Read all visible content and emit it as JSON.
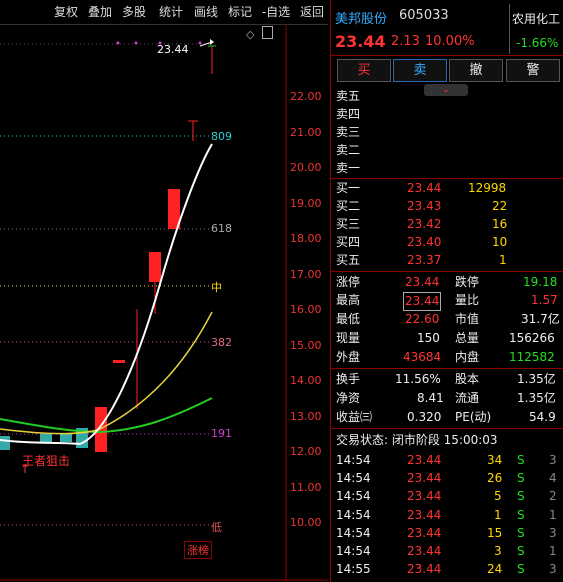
{
  "toolbar": {
    "items": [
      "复权",
      "叠加",
      "多股",
      "统计",
      "画线",
      "标记",
      "-自选",
      "返回"
    ]
  },
  "chart": {
    "price_label": "23.44",
    "y_ticks": [
      "22.00",
      "21.00",
      "20.00",
      "19.00",
      "18.00",
      "17.00",
      "16.00",
      "15.00",
      "14.00",
      "13.00",
      "12.00",
      "11.00",
      "10.00"
    ],
    "fib_labels": [
      "809",
      "618",
      "中",
      "382",
      "191",
      "低"
    ],
    "annotation": "王者狙击",
    "bottom_tag": "涨榜",
    "colors": {
      "white_line": "#ffffff",
      "yellow_line": "#e8d23a",
      "green_line": "#22cc22",
      "up_candle": "#ff2222"
    }
  },
  "stock": {
    "name": "美邦股份",
    "code": "605033",
    "sector": "农用化工",
    "sector_change": "-1.66%",
    "price": "23.44",
    "change": "2.13",
    "change_pct": "10.00%"
  },
  "actions": {
    "buy": "买",
    "sell": "卖",
    "cancel": "撤",
    "alert": "警"
  },
  "asks": [
    {
      "label": "卖五",
      "price": "",
      "vol": ""
    },
    {
      "label": "卖四",
      "price": "",
      "vol": ""
    },
    {
      "label": "卖三",
      "price": "",
      "vol": ""
    },
    {
      "label": "卖二",
      "price": "",
      "vol": ""
    },
    {
      "label": "卖一",
      "price": "",
      "vol": ""
    }
  ],
  "bids": [
    {
      "label": "买一",
      "price": "23.44",
      "vol": "12998"
    },
    {
      "label": "买二",
      "price": "23.43",
      "vol": "22"
    },
    {
      "label": "买三",
      "price": "23.42",
      "vol": "16"
    },
    {
      "label": "买四",
      "price": "23.40",
      "vol": "10"
    },
    {
      "label": "买五",
      "price": "23.37",
      "vol": "1"
    }
  ],
  "stats": [
    {
      "l1": "涨停",
      "v1": "23.44",
      "l2": "跌停",
      "v2": "19.18"
    },
    {
      "l1": "最高",
      "v1": "23.44",
      "l2": "量比",
      "v2": "1.57"
    },
    {
      "l1": "最低",
      "v1": "22.60",
      "l2": "市值",
      "v2": "31.7亿"
    },
    {
      "l1": "现量",
      "v1": "150",
      "l2": "总量",
      "v2": "156266"
    },
    {
      "l1": "外盘",
      "v1": "43684",
      "l2": "内盘",
      "v2": "112582"
    }
  ],
  "stats2": [
    {
      "l1": "换手",
      "v1": "11.56%",
      "l2": "股本",
      "v2": "1.35亿"
    },
    {
      "l1": "净资",
      "v1": "8.41",
      "l2": "流通",
      "v2": "1.35亿"
    },
    {
      "l1": "收益㈢",
      "v1": "0.320",
      "l2": "PE(动)",
      "v2": "54.9"
    }
  ],
  "status_line": "交易状态: 闭市阶段 15:00:03",
  "ticks": [
    {
      "time": "14:54",
      "price": "23.44",
      "vol": "34",
      "side": "S",
      "n": "3"
    },
    {
      "time": "14:54",
      "price": "23.44",
      "vol": "26",
      "side": "S",
      "n": "4"
    },
    {
      "time": "14:54",
      "price": "23.44",
      "vol": "5",
      "side": "S",
      "n": "2"
    },
    {
      "time": "14:54",
      "price": "23.44",
      "vol": "1",
      "side": "S",
      "n": "1"
    },
    {
      "time": "14:54",
      "price": "23.44",
      "vol": "15",
      "side": "S",
      "n": "3"
    },
    {
      "time": "14:54",
      "price": "23.44",
      "vol": "3",
      "side": "S",
      "n": "1"
    },
    {
      "time": "14:55",
      "price": "23.44",
      "vol": "24",
      "side": "S",
      "n": "3"
    }
  ]
}
